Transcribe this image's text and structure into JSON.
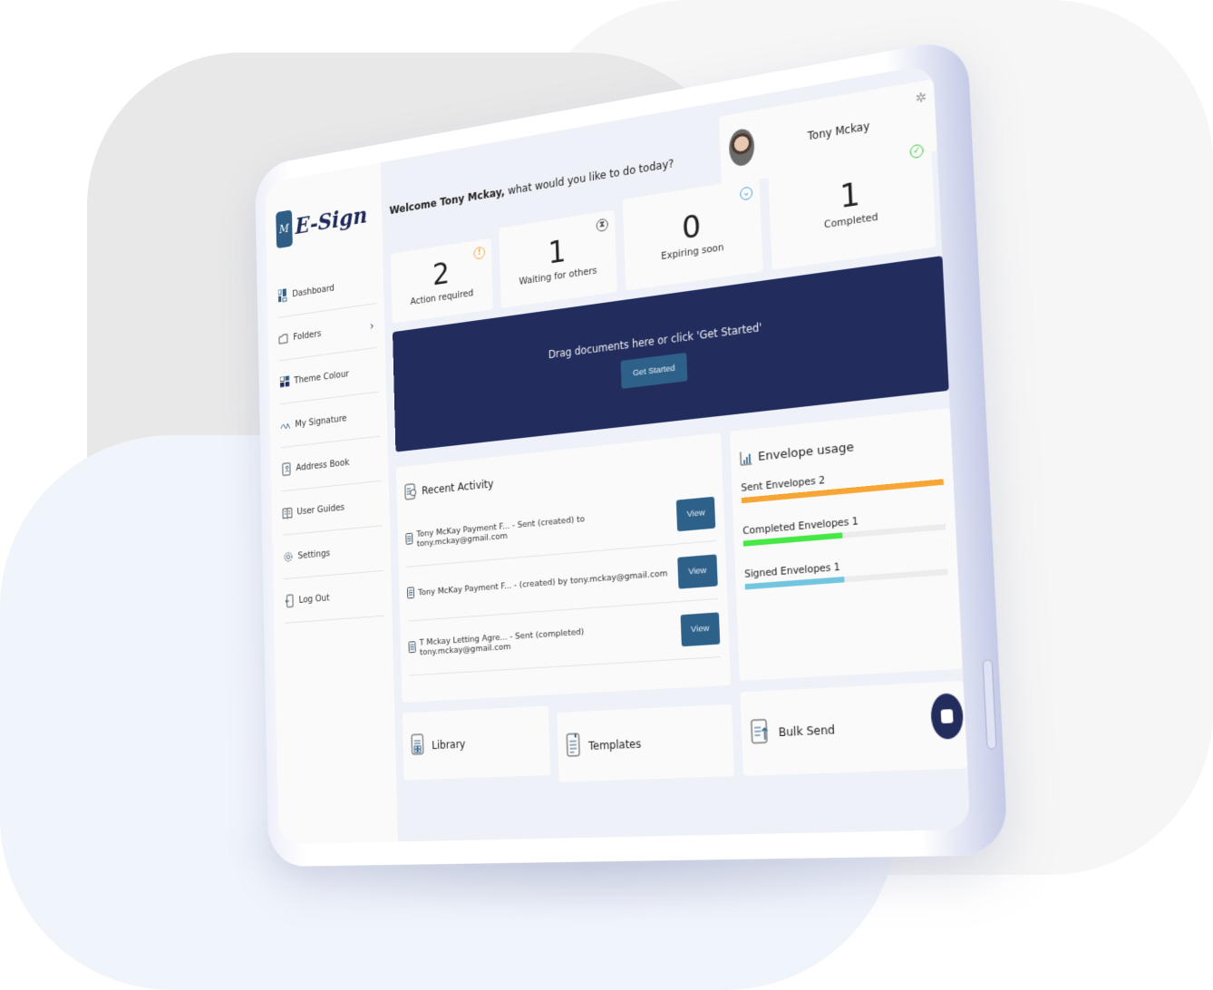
{
  "app": {
    "logo_text": "E-Sign",
    "logo_mark": "M"
  },
  "sidebar": {
    "items": [
      {
        "label": "Dashboard",
        "icon": "dashboard-icon"
      },
      {
        "label": "Folders",
        "icon": "folder-icon",
        "has_chevron": true
      },
      {
        "label": "Theme Colour",
        "icon": "palette-icon"
      },
      {
        "label": "My Signature",
        "icon": "signature-icon"
      },
      {
        "label": "Address Book",
        "icon": "address-book-icon"
      },
      {
        "label": "User Guides",
        "icon": "book-icon"
      },
      {
        "label": "Settings",
        "icon": "gear-icon"
      },
      {
        "label": "Log Out",
        "icon": "logout-icon"
      }
    ],
    "chevron": "›"
  },
  "header": {
    "welcome_bold": "Welcome Tony Mckay,",
    "welcome_rest": " what would you like to do today?"
  },
  "profile": {
    "name": "Tony Mckay",
    "settings_icon": "✲"
  },
  "stats": [
    {
      "value": "2",
      "label": "Action required",
      "icon": "!",
      "icon_name": "alert-icon",
      "color": "#f4a43a"
    },
    {
      "value": "1",
      "label": "Waiting for others",
      "icon": "⧗",
      "icon_name": "hourglass-icon",
      "color": "#555555"
    },
    {
      "value": "0",
      "label": "Expiring soon",
      "icon": "⌄",
      "icon_name": "clock-icon",
      "color": "#4aa3d8"
    },
    {
      "value": "1",
      "label": "Completed",
      "icon": "✓",
      "icon_name": "check-circle-icon",
      "color": "#3ccc3c"
    }
  ],
  "dropzone": {
    "text": "Drag documents here or click 'Get Started'",
    "button": "Get Started"
  },
  "recent_activity": {
    "title": "Recent Activity",
    "items": [
      {
        "text": "Tony McKay Payment F... - Sent (created) to tony.mckay@gmail.com",
        "button": "View"
      },
      {
        "text": "Tony McKay Payment F... - (created) by tony.mckay@gmail.com",
        "button": "View"
      },
      {
        "text": "T Mckay Letting Agre... - Sent (completed) tony.mckay@gmail.com",
        "button": "View"
      }
    ]
  },
  "envelope_usage": {
    "title": "Envelope usage",
    "bars": [
      {
        "label": "Sent Envelopes 2",
        "value": 2,
        "max": 2,
        "color": "#f7a534"
      },
      {
        "label": "Completed Envelopes 1",
        "value": 1,
        "max": 2,
        "color": "#46e846"
      },
      {
        "label": "Signed Envelopes 1",
        "value": 1,
        "max": 2,
        "color": "#72c5df"
      }
    ]
  },
  "tiles": [
    {
      "label": "Library",
      "icon": "library-icon"
    },
    {
      "label": "Templates",
      "icon": "templates-icon"
    },
    {
      "label": "Bulk Send",
      "icon": "bulk-send-icon"
    }
  ],
  "colors": {
    "primary": "#222d5e",
    "button": "#2d6189"
  }
}
